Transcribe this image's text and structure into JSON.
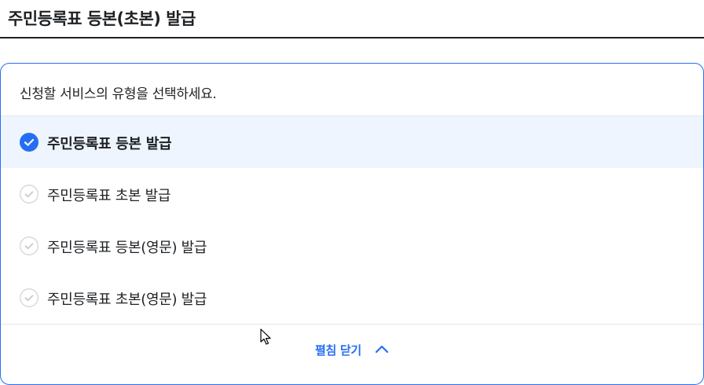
{
  "page": {
    "title": "주민등록표 등본(초본) 발급"
  },
  "selector": {
    "description": "신청할 서비스의 유형을 선택하세요.",
    "options": [
      {
        "label": "주민등록표 등본 발급",
        "selected": true
      },
      {
        "label": "주민등록표 초본 발급",
        "selected": false
      },
      {
        "label": "주민등록표 등본(영문) 발급",
        "selected": false
      },
      {
        "label": "주민등록표 초본(영문) 발급",
        "selected": false
      }
    ],
    "toggle_label": "펼침 닫기",
    "toggle_icon": "chevron-up-icon"
  },
  "colors": {
    "accent": "#256ef4",
    "selected_bg": "#eff5ff",
    "unchecked_icon": "#c6c9cd",
    "text": "#1e2124"
  }
}
